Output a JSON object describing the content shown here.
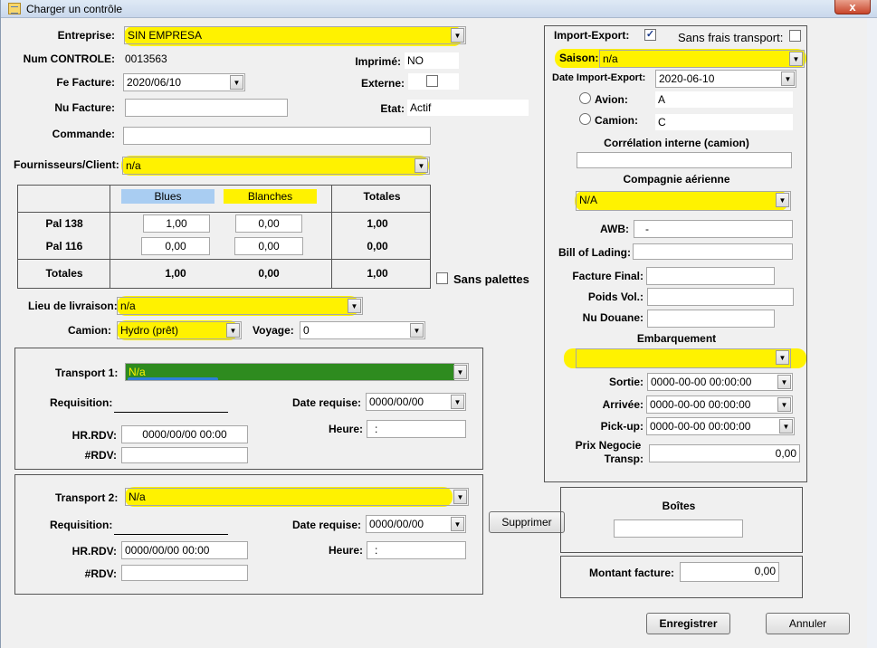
{
  "window": {
    "title": "Charger un contrôle",
    "close_label": "x"
  },
  "entreprise": {
    "label": "Entreprise:",
    "value": "SIN EMPRESA"
  },
  "num_controle": {
    "label": "Num CONTROLE:",
    "value": "0013563"
  },
  "imprime": {
    "label": "Imprimé:",
    "value": "NO"
  },
  "fe_facture": {
    "label": "Fe Facture:",
    "value": "2020/06/10"
  },
  "externe": {
    "label": "Externe:"
  },
  "nu_facture": {
    "label": "Nu Facture:",
    "value": ""
  },
  "etat": {
    "label": "Etat:",
    "value": "Actif"
  },
  "commande": {
    "label": "Commande:",
    "value": ""
  },
  "fournisseurs": {
    "label": "Fournisseurs/Client:",
    "value": "n/a"
  },
  "pallet_table": {
    "col_blues": "Blues",
    "col_blanches": "Blanches",
    "col_totales": "Totales",
    "rows": [
      {
        "label": "Pal 138",
        "blues": "1,00",
        "blanches": "0,00",
        "total": "1,00"
      },
      {
        "label": "Pal 116",
        "blues": "0,00",
        "blanches": "0,00",
        "total": "0,00"
      }
    ],
    "totals": {
      "label": "Totales",
      "blues": "1,00",
      "blanches": "0,00",
      "total": "1,00"
    }
  },
  "sans_palettes": {
    "label": "Sans palettes"
  },
  "lieu_livraison": {
    "label": "Lieu de livraison:",
    "value": "n/a"
  },
  "camion": {
    "label": "Camion:",
    "value": "Hydro (prêt)"
  },
  "voyage": {
    "label": "Voyage:",
    "value": "0"
  },
  "transport1": {
    "label": "Transport 1:",
    "value": "N/a",
    "requisition_label": "Requisition:",
    "date_requise_label": "Date requise:",
    "date_requise_value": "0000/00/00",
    "heure_label": "Heure:",
    "heure_value": ":",
    "hrrdv_label": "HR.RDV:",
    "hrrdv_value": "0000/00/00 00:00",
    "rdv_label": "#RDV:",
    "rdv_value": ""
  },
  "transport2": {
    "label": "Transport 2:",
    "value": "N/a",
    "requisition_label": "Requisition:",
    "date_requise_label": "Date requise:",
    "date_requise_value": "0000/00/00",
    "heure_label": "Heure:",
    "heure_value": ":",
    "hrrdv_label": "HR.RDV:",
    "hrrdv_value": "0000/00/00 00:00",
    "rdv_label": "#RDV:",
    "rdv_value": ""
  },
  "supprimer_label": "Supprimer",
  "right_panel": {
    "import_export_label": "Import-Export:",
    "import_export_checked": "✓",
    "sans_frais_label": "Sans frais transport:",
    "saison_label": "Saison:",
    "saison_value": "n/a",
    "date_ie_label": "Date Import-Export:",
    "date_ie_value": "2020-06-10",
    "avion_label": "Avion:",
    "avion_value": "A",
    "camion_label": "Camion:",
    "camion_value": "C",
    "correlation_label": "Corrélation interne (camion)",
    "correlation_value": "",
    "compagnie_label": "Compagnie aérienne",
    "compagnie_value": "N/A",
    "awb_label": "AWB:",
    "awb_value": "-",
    "bill_label": "Bill of Lading:",
    "bill_value": "",
    "facture_final_label": "Facture Final:",
    "facture_final_value": "",
    "poids_label": "Poids Vol.:",
    "poids_value": "",
    "nu_douane_label": "Nu Douane:",
    "nu_douane_value": "",
    "embarquement_label": "Embarquement",
    "embarquement_value": "",
    "sortie_label": "Sortie:",
    "sortie_value": "0000-00-00 00:00:00",
    "arrivee_label": "Arrivée:",
    "arrivee_value": "0000-00-00 00:00:00",
    "pickup_label": "Pick-up:",
    "pickup_value": "0000-00-00 00:00:00",
    "prix_label_1": "Prix Negocie",
    "prix_label_2": "Transp:",
    "prix_value": "0,00"
  },
  "boites": {
    "label": "Boîtes",
    "value": ""
  },
  "montant": {
    "label": "Montant facture:",
    "value": "0,00"
  },
  "buttons": {
    "enregistrer": "Enregistrer",
    "annuler": "Annuler"
  },
  "colors": {
    "highlight": "#fff200",
    "transport1_fill": "#2e8b1f",
    "blues_bg": "#a9cdf2"
  }
}
